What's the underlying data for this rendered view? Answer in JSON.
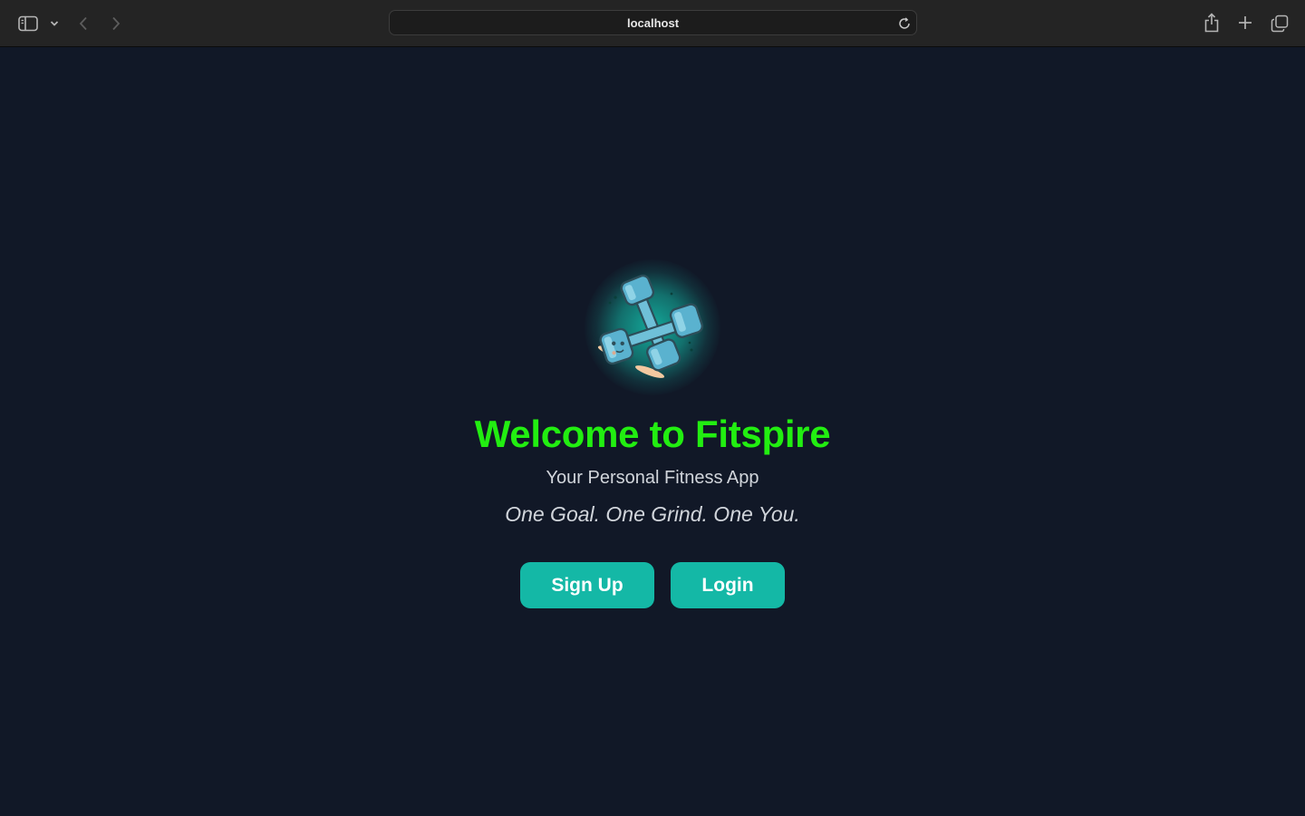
{
  "browser": {
    "address": "localhost",
    "icons": {
      "sidebar": "sidebar-icon",
      "sidebar_menu": "chevron-down-icon",
      "back": "chevron-left-icon",
      "forward": "chevron-right-icon",
      "reload": "reload-icon",
      "share": "share-icon",
      "new_tab": "plus-icon",
      "tab_overview": "tabs-icon"
    }
  },
  "hero": {
    "icon": "dumbbells-icon",
    "title": "Welcome to Fitspire",
    "subtitle": "Your Personal Fitness App",
    "tagline": "One Goal. One Grind. One You."
  },
  "actions": {
    "signup_label": "Sign Up",
    "login_label": "Login"
  },
  "colors": {
    "background": "#111827",
    "title": "#22ee11",
    "accent": "#14b8a6",
    "text_muted": "#d1d5db"
  }
}
